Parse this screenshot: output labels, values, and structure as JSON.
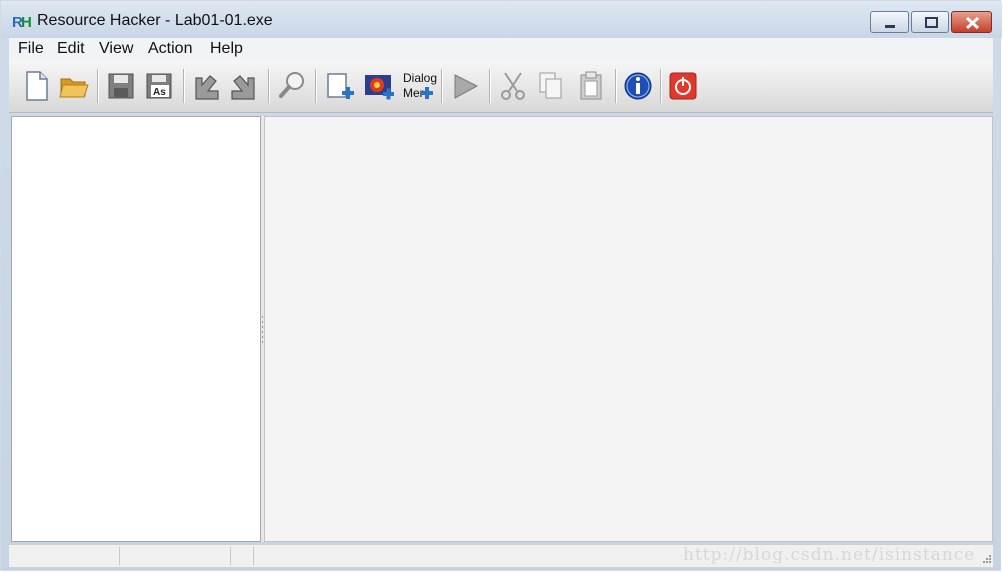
{
  "window": {
    "title": "Resource Hacker - Lab01-01.exe"
  },
  "menu": {
    "items": [
      "File",
      "Edit",
      "View",
      "Action",
      "Help"
    ]
  },
  "toolbar": {
    "dialog_menu_top": "Dialog",
    "dialog_menu_bottom": "Mer",
    "buttons": [
      "new-file",
      "open-folder",
      "save",
      "save-as",
      "back",
      "forward",
      "search",
      "add-resource",
      "add-image",
      "dialog-menu",
      "run",
      "cut",
      "copy",
      "paste",
      "info",
      "exit"
    ]
  },
  "watermark": "http://blog.csdn.net/isinstance",
  "colors": {
    "close_button": "#c4402a",
    "info_blue": "#1f4fb5",
    "exit_red": "#e0382d",
    "open_folder": "#f0b83b"
  }
}
